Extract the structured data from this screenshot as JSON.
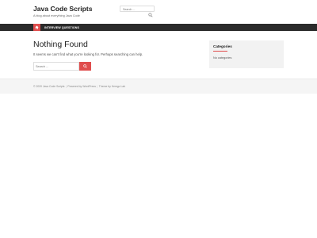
{
  "site": {
    "title": "Java Code Scripts",
    "tagline": "A blog about everything Java Code"
  },
  "header_search": {
    "placeholder": "Search ...",
    "icon": "search-icon"
  },
  "nav": {
    "home_icon": "home-icon",
    "items": [
      {
        "label": "INTERVIEW QUESTIONS"
      }
    ]
  },
  "main": {
    "title": "Nothing Found",
    "text": "It seems we can't find what you're looking for. Perhaps searching can help.",
    "search_placeholder": "Search ...",
    "search_icon": "search-icon"
  },
  "sidebar": {
    "widget_title": "Categories",
    "widget_text": "No categories"
  },
  "footer": {
    "copyright": "© 2020 Java Code Scripts",
    "powered": "Powered by WordPress",
    "theme": "Theme by Kemgo Lab"
  },
  "colors": {
    "accent": "#e04e4e",
    "navbar": "#2b2b2b",
    "footer_bg": "#f5f5f5",
    "widget_bg": "#f2f2f2"
  }
}
